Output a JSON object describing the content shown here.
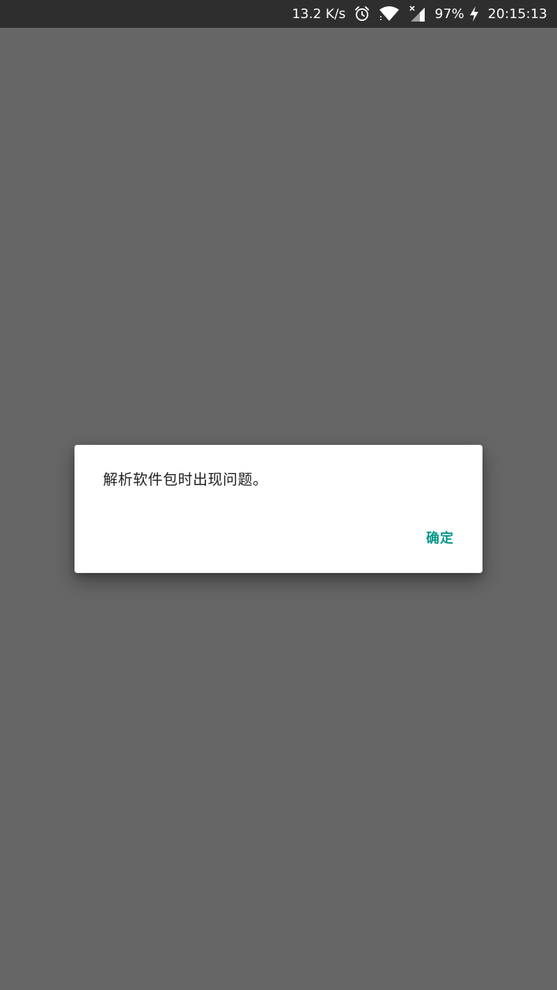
{
  "status_bar": {
    "network_speed": "13.2 K/s",
    "battery_percent": "97%",
    "time": "20:15:13",
    "icons": [
      "alarm-icon",
      "wifi-icon",
      "cellular-no-service-icon",
      "charging-icon"
    ]
  },
  "dialog": {
    "message": "解析软件包时出现问题。",
    "confirm_label": "确定"
  },
  "colors": {
    "accent": "#009688",
    "status_bar_bg": "#2e2e2e",
    "scrim": "#666666",
    "dialog_bg": "#ffffff"
  }
}
